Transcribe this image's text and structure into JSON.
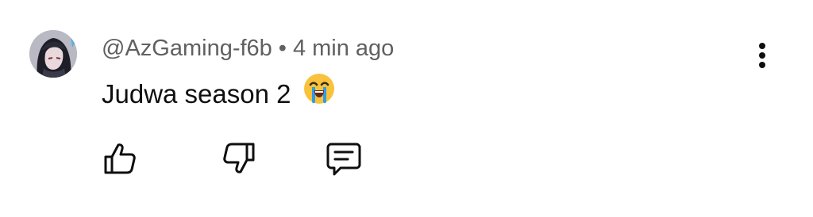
{
  "comment": {
    "handle": "@AzGaming-f6b",
    "separator": "•",
    "time_ago": "4 min ago",
    "text": "Judwa season 2"
  },
  "icons": {
    "avatar": "avatar-image",
    "emoji": "loudly-crying-face-emoji",
    "more": "more-vertical-icon",
    "like": "thumbs-up-icon",
    "dislike": "thumbs-down-icon",
    "reply": "reply-comment-icon"
  },
  "colors": {
    "meta_text": "#606060",
    "body_text": "#0f0f0f",
    "icon": "#0f0f0f",
    "emoji_face": "#f9c23c",
    "emoji_tears": "#2f9be6"
  }
}
